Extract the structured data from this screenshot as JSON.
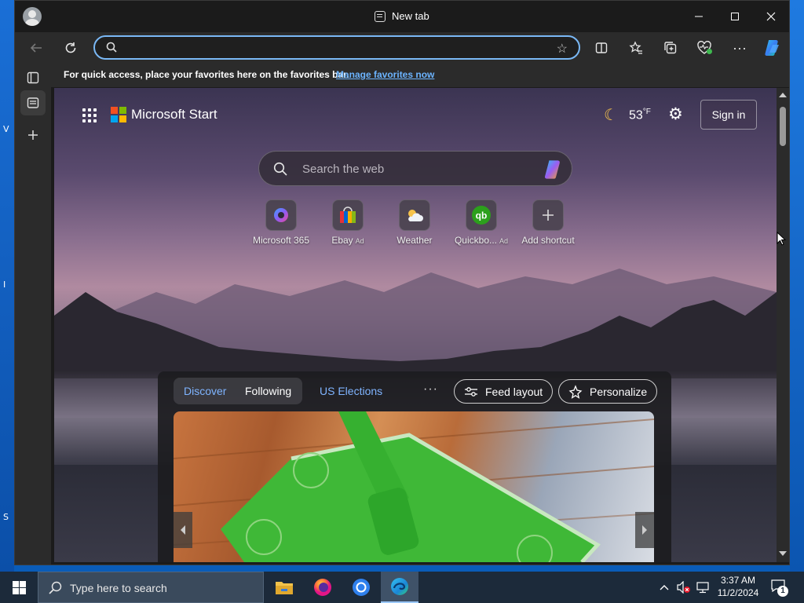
{
  "desktop": {
    "left_letters": [
      "V",
      "I",
      "S"
    ]
  },
  "browser": {
    "tab_title": "New tab",
    "address_value": "",
    "favorites_bar": {
      "message": "For quick access, place your favorites here on the favorites bar.",
      "link": "Manage favorites now"
    }
  },
  "start_page": {
    "brand": "Microsoft Start",
    "weather": {
      "temperature": "53",
      "unit": "°F",
      "icon": "moon-icon"
    },
    "sign_in": "Sign in",
    "search_placeholder": "Search the web",
    "shortcuts": [
      {
        "label": "Microsoft 365",
        "ad": ""
      },
      {
        "label": "Ebay",
        "ad": "Ad"
      },
      {
        "label": "Weather",
        "ad": ""
      },
      {
        "label": "Quickbo...",
        "ad": "Ad"
      },
      {
        "label": "Add shortcut",
        "ad": ""
      }
    ],
    "feed": {
      "tabs": [
        "Discover",
        "Following"
      ],
      "active_tab": "Discover",
      "extra_tab": "US Elections",
      "more": "···",
      "feed_layout": "Feed layout",
      "personalize": "Personalize"
    }
  },
  "taskbar": {
    "search_placeholder": "Type here to search",
    "time": "3:37 AM",
    "date": "11/2/2024",
    "notification_count": "1",
    "apps": [
      "file-explorer-icon",
      "firefox-icon",
      "chrome-icon",
      "edge-icon"
    ]
  },
  "colors": {
    "accent": "#7ab8f5",
    "link": "#6cb4ff",
    "taskbar": "#1c2a3a"
  }
}
